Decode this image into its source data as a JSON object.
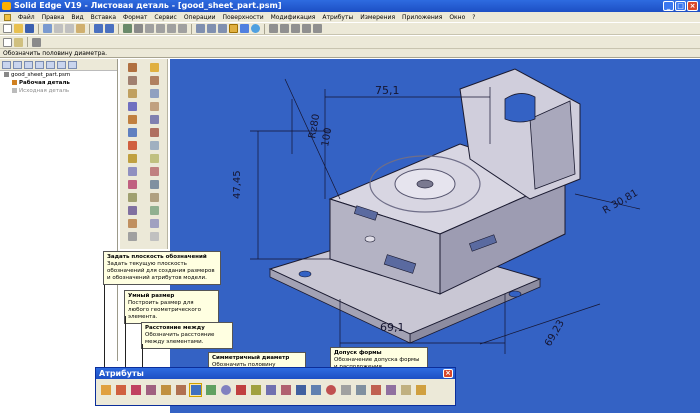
{
  "window": {
    "title": "Solid Edge V19 - Листовая деталь - [good_sheet_part.psm]",
    "buttons": [
      "_",
      "□",
      "×"
    ]
  },
  "menu": [
    "Файл",
    "Правка",
    "Вид",
    "Вставка",
    "Формат",
    "Сервис",
    "Операции",
    "Поверхности",
    "Модификация",
    "Атрибуты",
    "Измерения",
    "Приложения",
    "Окно",
    "?"
  ],
  "hint": "Обозначить половину диаметра.",
  "pathfinder": {
    "items": [
      {
        "label": "good_sheet_part.psm",
        "level": 1,
        "gray": false
      },
      {
        "label": "Рабочая деталь",
        "level": 2,
        "gray": false
      },
      {
        "label": "Исходная деталь",
        "level": 2,
        "gray": true
      }
    ]
  },
  "drawing": {
    "dims": [
      "75,1",
      "47,45",
      "Rz80",
      "100",
      "R 30,81",
      "69,1",
      "69,23"
    ]
  },
  "tooltips": [
    {
      "title": "Задать плоскость обозначений",
      "desc": "Задать текущую плоскость обозначений для создания размеров и обозначений атрибутов модели."
    },
    {
      "title": "Умный размер",
      "desc": "Построить размер для любого геометрического элемента."
    },
    {
      "title": "Расстояние между",
      "desc": "Обозначить расстояние между элементами."
    },
    {
      "title": "Симметричный диаметр",
      "desc": "Обозначить половину диаметра."
    },
    {
      "title": "Допуск формы",
      "desc": "Обозначение допуска формы и расположения поверхностей."
    }
  ],
  "attr_toolbar": {
    "title": "Атрибуты",
    "close": "×"
  },
  "colors": {
    "viewport": "#3462c4",
    "titlebar": "#1d4fc4",
    "tooltip": "#ffffe1",
    "part": "#c9c7d4"
  }
}
